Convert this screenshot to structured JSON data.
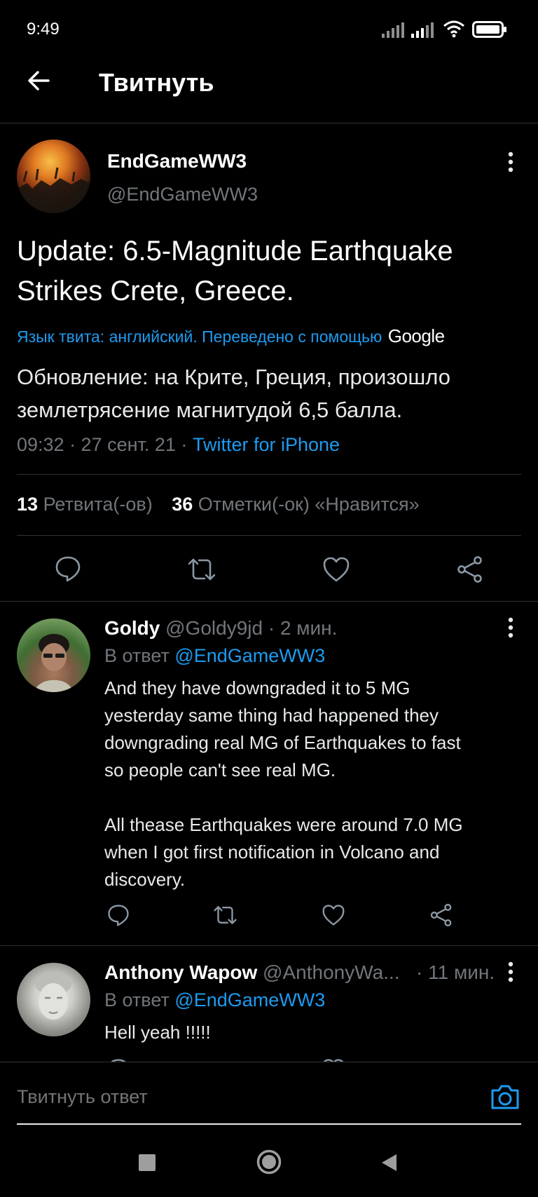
{
  "status_bar": {
    "time": "9:49"
  },
  "header": {
    "title": "Твитнуть"
  },
  "tweet": {
    "display_name": "EndGameWW3",
    "handle": "@EndGameWW3",
    "text_line1": "Update: 6.5-Magnitude Earthquake",
    "text_line2": "Strikes Crete, Greece.",
    "translation_note": "Язык твита: английский. Переведено с помощью",
    "translator": "Google",
    "translated_line1": "Обновление: на Крите, Греция, произошло",
    "translated_line2": "землетрясение магнитудой 6,5 балла.",
    "timestamp": "09:32 · 27 сент. 21 ·",
    "source": "Twitter for iPhone",
    "retweets_count": "13",
    "retweets_label": "Ретвита(-ов)",
    "likes_count": "36",
    "likes_label": "Отметки(-ок) «Нравится»"
  },
  "replies": [
    {
      "display_name": "Goldy",
      "meta": "@Goldy9jd · 2 мин.",
      "reply_to_label": "В ответ",
      "reply_to": "@EndGameWW3",
      "lines": [
        "And they have downgraded it to 5 MG",
        "yesterday same thing had happened they",
        "downgrading real MG of Earthquakes to fast",
        "so people can't see real MG.",
        "",
        "All thease Earthquakes were around 7.0 MG",
        "when I got first notification in Volcano and",
        "discovery."
      ]
    },
    {
      "display_name": "Anthony Wapow",
      "handle": "@AnthonyWa...",
      "time": "· 11 мин.",
      "reply_to_label": "В ответ",
      "reply_to": "@EndGameWW3",
      "lines": [
        "Hell yeah !!!!!"
      ]
    }
  ],
  "compose": {
    "placeholder": "Твитнуть ответ"
  },
  "colors": {
    "accent": "#1d9bf0",
    "background": "#000000",
    "muted": "#71767b"
  },
  "icons": [
    "back-arrow-icon",
    "more-icon",
    "reply-icon",
    "retweet-icon",
    "like-icon",
    "share-icon",
    "camera-icon",
    "signal-icon",
    "wifi-icon",
    "battery-icon"
  ]
}
